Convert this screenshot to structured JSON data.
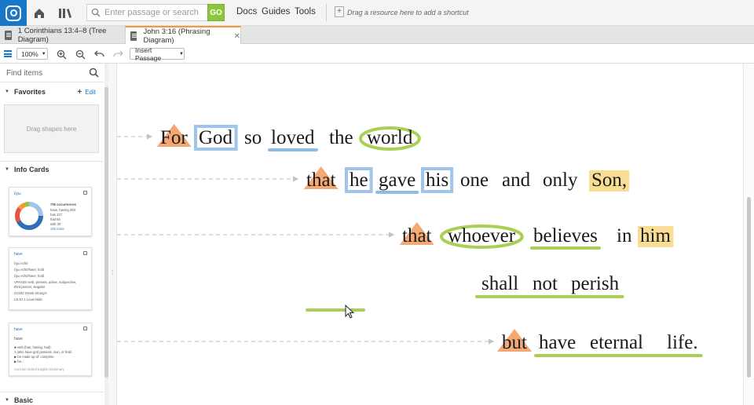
{
  "topbar": {
    "search_placeholder": "Enter passage or search",
    "go_label": "GO",
    "menus": [
      "Docs",
      "Guides",
      "Tools"
    ],
    "shortcut_hint": "Drag a resource here to add a shortcut"
  },
  "tabs": [
    {
      "label": "1 Corinthians 13:4–8 (Tree Diagram)",
      "active": false
    },
    {
      "label": "John 3:16 (Phrasing Diagram)",
      "active": true
    }
  ],
  "toolbar": {
    "zoom": "100%",
    "insert_label": "Insert Passage"
  },
  "sidebar": {
    "find_placeholder": "Find items",
    "favorites_title": "Favorites",
    "favorites_edit": "Edit",
    "drag_hint": "Drag shapes here",
    "info_cards_title": "Info Cards",
    "basic_title": "Basic",
    "cards": [
      {
        "title": "ἔχω",
        "lines": [
          "706 occurrences",
          "have, having 293",
          "has 127",
          "had 65",
          "with 30",
          "192 more"
        ]
      },
      {
        "title": "have",
        "lines": [
          "ἔχω echō",
          "ἔχω echō/have; hold",
          "ἔχω echō/have; hold",
          "VPAS3S verb, present, active, subjunctive,",
          "third person, singular",
          "G2192 Greek Strong's",
          "LN 57.1 Louw Nida"
        ]
      },
      {
        "title": "have",
        "lines": [
          "have",
          "■ verb (has, having, had)",
          "1 (also have got) possess, own, or hold.",
          "▶ be made up of; comprise.",
          "▶ be...",
          "Concise Oxford English Dictionary"
        ]
      }
    ]
  },
  "passage": {
    "lines": [
      [
        "For",
        "God",
        "so",
        "loved",
        "the",
        "world"
      ],
      [
        "that",
        "he",
        "gave",
        "his",
        "one",
        "and",
        "only",
        "Son,"
      ],
      [
        "that",
        "whoever",
        "believes",
        "in",
        "him"
      ],
      [
        "shall",
        "not",
        "perish"
      ],
      [
        "but",
        "have",
        "eternal",
        "life."
      ]
    ]
  },
  "colors": {
    "accent": "#1877c8",
    "go": "#8cc63f",
    "tab_active": "#f29a38",
    "triangle": "#f3a066",
    "box": "#9fc5ea",
    "circle": "#a9cf55",
    "highlight": "#f8d98a",
    "underline_blue": "#8fbbe6",
    "underline_green": "#a9cf55"
  },
  "icons": [
    "home-icon",
    "library-icon",
    "search-icon",
    "zoom-in-icon",
    "zoom-out-icon",
    "undo-icon",
    "redo-icon",
    "menu-icon",
    "pin-icon"
  ]
}
